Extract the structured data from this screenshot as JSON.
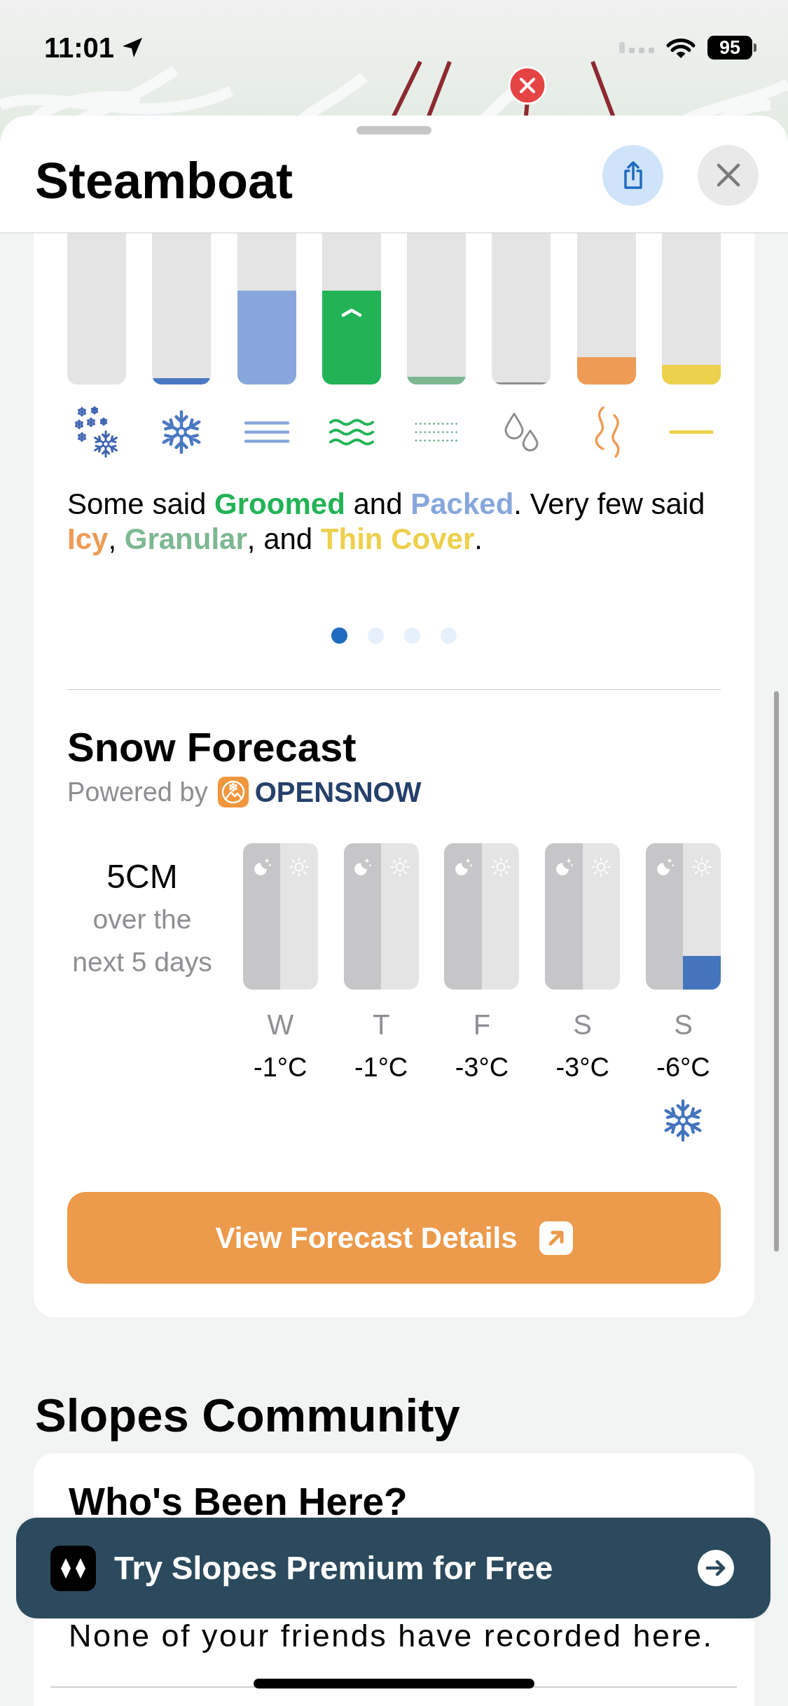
{
  "status_bar": {
    "time": "11:01",
    "battery": "95"
  },
  "sheet": {
    "title": "Steamboat"
  },
  "conditions": {
    "bars": [
      {
        "kind": "powder",
        "color": "#3d63b0",
        "top": false
      },
      {
        "kind": "fresh",
        "level": 0.04,
        "color": "#4a78c0",
        "top": false
      },
      {
        "kind": "packed",
        "level": 0.62,
        "color": "#87a7dc",
        "top": false
      },
      {
        "kind": "groomed",
        "level": 0.62,
        "color": "#22b356",
        "top": true
      },
      {
        "kind": "granular",
        "level": 0.05,
        "color": "#7db892",
        "top": false
      },
      {
        "kind": "slush",
        "level": 0.012,
        "color": "#8e8e8e",
        "top": false
      },
      {
        "kind": "icy",
        "level": 0.18,
        "color": "#ee9b55",
        "top": false
      },
      {
        "kind": "thin",
        "level": 0.13,
        "color": "#edd04b",
        "top": false
      }
    ],
    "summary": [
      {
        "text": "Some said "
      },
      {
        "text": "Groomed",
        "color": "#22b356"
      },
      {
        "text": " and "
      },
      {
        "text": "Packed",
        "color": "#87a7dc"
      },
      {
        "text": ". Very few said "
      },
      {
        "text": "Icy",
        "color": "#ee9b55"
      },
      {
        "text": ", "
      },
      {
        "text": "Granular",
        "color": "#7db892"
      },
      {
        "text": ", and "
      },
      {
        "text": "Thin Cover",
        "color": "#edd04b"
      },
      {
        "text": "."
      }
    ],
    "pages": [
      {
        "selected": true
      },
      {
        "selected": false
      },
      {
        "selected": false
      },
      {
        "selected": false
      }
    ]
  },
  "snow_forecast": {
    "title": "Snow Forecast",
    "powered_by": "Powered by",
    "provider": "OPENSNOW",
    "total": "5CM",
    "total_caption": "over the next 5 days",
    "days": [
      {
        "day": "W",
        "temp": "-1°C",
        "snow": false,
        "periods": [
          {
            "kind": "night"
          },
          {
            "kind": "day"
          }
        ]
      },
      {
        "day": "T",
        "temp": "-1°C",
        "snow": false,
        "periods": [
          {
            "kind": "night"
          },
          {
            "kind": "day"
          }
        ]
      },
      {
        "day": "F",
        "temp": "-3°C",
        "snow": false,
        "periods": [
          {
            "kind": "night"
          },
          {
            "kind": "day"
          }
        ]
      },
      {
        "day": "S",
        "temp": "-3°C",
        "snow": false,
        "periods": [
          {
            "kind": "night"
          },
          {
            "kind": "day"
          }
        ]
      },
      {
        "day": "S",
        "temp": "-6°C",
        "snow": true,
        "periods": [
          {
            "kind": "night"
          },
          {
            "kind": "day",
            "level": 0.23
          }
        ]
      }
    ],
    "button": "View Forecast Details"
  },
  "community": {
    "title": "Slopes Community",
    "card_title": "Who's Been Here?",
    "message": "None of your friends have recorded here."
  },
  "promo_banner": {
    "text": "Try Slopes Premium for Free"
  }
}
